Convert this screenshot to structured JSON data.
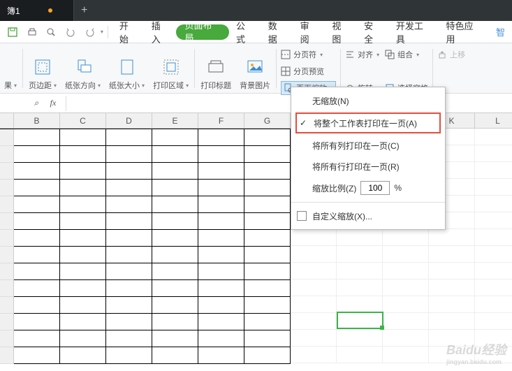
{
  "titlebar": {
    "tab_name": "簿1"
  },
  "menubar": {
    "items": [
      "开始",
      "插入",
      "页面布局",
      "公式",
      "数据",
      "审阅",
      "视图",
      "安全",
      "开发工具",
      "特色应用",
      "智"
    ]
  },
  "ribbon": {
    "result": "果",
    "margins": "页边距",
    "orientation": "纸张方向",
    "size": "纸张大小",
    "print_area": "打印区域",
    "print_titles": "打印标题",
    "bg_image": "背景图片",
    "breaks": "分页符",
    "preview": "分页预览",
    "page_zoom": "页面缩放",
    "align": "对齐",
    "rotate": "旋转",
    "group": "组合",
    "select_pane": "选择窗格",
    "move_up": "上移"
  },
  "formulabar": {
    "fx": "fx"
  },
  "columns": [
    "B",
    "C",
    "D",
    "E",
    "F",
    "G",
    "",
    "",
    "",
    "K",
    "L"
  ],
  "dropdown": {
    "no_scale": "无缩放(N)",
    "fit_sheet": "将整个工作表打印在一页(A)",
    "fit_cols": "将所有列打印在一页(C)",
    "fit_rows": "将所有行打印在一页(R)",
    "scale_label": "缩放比例(Z)",
    "scale_value": "100",
    "scale_pct": "%",
    "custom": "自定义缩放(X)..."
  },
  "watermark": {
    "brand": "Baidu经验",
    "sub": "jingyan.baidu.com"
  }
}
